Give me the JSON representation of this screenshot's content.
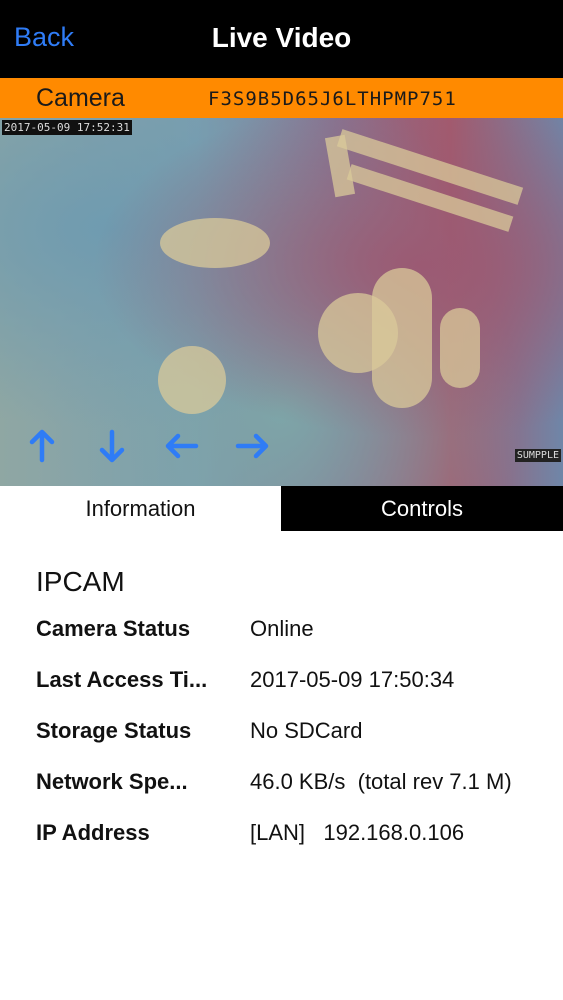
{
  "navbar": {
    "back_label": "Back",
    "title": "Live Video"
  },
  "camera": {
    "label": "Camera",
    "id": "F3S9B5D65J6LTHPMP751"
  },
  "video": {
    "timestamp": "2017-05-09 17:52:31",
    "watermark": "SUMPPLE",
    "ptz": [
      {
        "name": "up-arrow-icon",
        "glyph": "↑"
      },
      {
        "name": "down-arrow-icon",
        "glyph": "↓"
      },
      {
        "name": "left-arrow-icon",
        "glyph": "←"
      },
      {
        "name": "right-arrow-icon",
        "glyph": "→"
      }
    ]
  },
  "tabs": {
    "information": "Information",
    "controls": "Controls"
  },
  "info": {
    "device_name": "IPCAM",
    "rows": [
      {
        "label": "Camera Status",
        "value": "Online"
      },
      {
        "label": "Last Access Ti...",
        "value": "2017-05-09 17:50:34"
      },
      {
        "label": "Storage Status",
        "value": "No SDCard"
      },
      {
        "label": "Network Spe...",
        "value": "46.0 KB/s  (total rev 7.1 M)"
      },
      {
        "label": "IP Address",
        "value": "[LAN]   192.168.0.106"
      }
    ]
  },
  "colors": {
    "accent": "#2f7cf6",
    "camera_bar": "#ff8a00",
    "navbar": "#000000"
  }
}
